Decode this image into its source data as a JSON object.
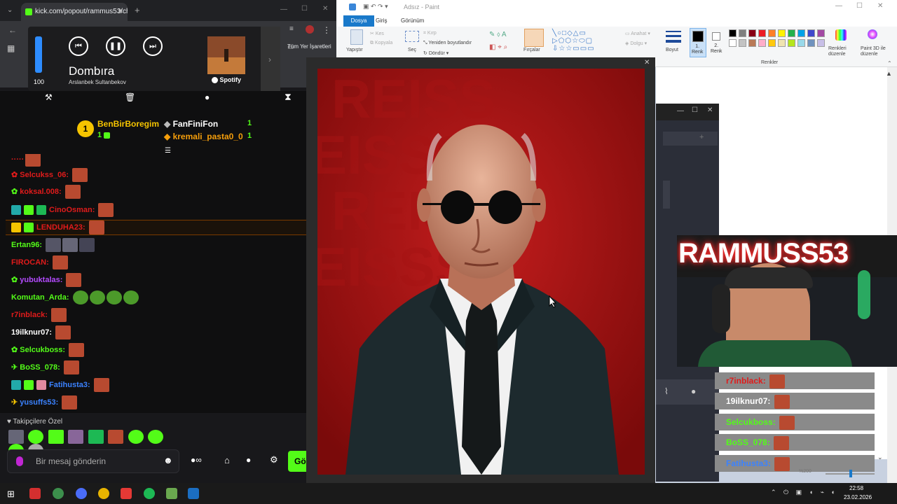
{
  "chrome": {
    "tab_title": "kick.com/popout/rammus53/ch",
    "bookmark": "Tüm Yer İşaretleri"
  },
  "spotify": {
    "volume": "100",
    "volume_level": 1.0,
    "track": "Dombıra",
    "artist": "Arslanbek Sultanbekov",
    "brand": "Spotify",
    "prev_icon": "skip-back-icon",
    "play_icon": "pause-icon",
    "next_icon": "skip-forward-icon"
  },
  "kick": {
    "leaderboard": [
      {
        "rank": "1",
        "name": "BenBirBoregim",
        "count": "1"
      },
      {
        "name": "FanFiniFon",
        "count": "1"
      },
      {
        "name": "kremali_pasta0_0",
        "count": "1"
      }
    ],
    "messages": [
      {
        "user": "Selcukss_06",
        "color": "#e01b1b"
      },
      {
        "user": "koksal.008",
        "color": "#e01b1b"
      },
      {
        "user": "CinoOsman",
        "color": "#e01b1b"
      },
      {
        "user": "LENDUHA23",
        "color": "#e01b1b"
      },
      {
        "user": "Ertan96",
        "color": "#53fc18"
      },
      {
        "user": "FIROCAN",
        "color": "#e01b1b"
      },
      {
        "user": "yubuktalas",
        "color": "#b44bff"
      },
      {
        "user": "Komutan_Arda",
        "color": "#53fc18"
      },
      {
        "user": "r7inblack",
        "color": "#e01b1b"
      },
      {
        "user": "19ilknur07",
        "color": "#ffffff"
      },
      {
        "user": "Selcukboss",
        "color": "#53fc18"
      },
      {
        "user": "BoSS_078",
        "color": "#53fc18"
      },
      {
        "user": "Fatihusta3",
        "color": "#3b82ff"
      },
      {
        "user": "yusuffs53",
        "color": "#3b82ff"
      }
    ],
    "followers_label": "Takipçilere Özel",
    "chat_placeholder": "Bir mesaj gönderin",
    "send_label": "Gö"
  },
  "paint": {
    "title": "Adsız - Paint",
    "menu": [
      "Dosya",
      "Giriş",
      "Görünüm"
    ],
    "ribbon": {
      "paste": "Yapıştır",
      "cut": "Kes",
      "copy": "Kopyala",
      "select": "Seç",
      "crop": "Kırp",
      "resize": "Yeniden boyutlandır",
      "rotate": "Döndür",
      "brushes": "Fırçalar",
      "outline": "Anahat",
      "fill": "Dolgu",
      "size": "Boyut",
      "color1": "1.\nRenk",
      "color2": "2.\nRenk",
      "edit_colors": "Renkleri düzenle",
      "paint3d": "Paint 3D ile düzenle",
      "colors_group": "Renkler"
    },
    "zoom": "%200",
    "palette": [
      "#000000",
      "#7f7f7f",
      "#880015",
      "#ed1c24",
      "#ff7f27",
      "#fff200",
      "#22b14c",
      "#00a2e8",
      "#3f48cc",
      "#a349a4",
      "#ffffff",
      "#c3c3c3",
      "#b97a57",
      "#ffaec9",
      "#ffc90e",
      "#efe4b0",
      "#b5e61d",
      "#99d9ea",
      "#7092be",
      "#c8bfe7"
    ]
  },
  "overlay": {
    "cam_text": "RAMMUSS53",
    "messages": [
      "r7inblack:",
      "19ilknur07:",
      "Selcukboss:",
      "BoSS_078:",
      "Fatihusta3:"
    ]
  },
  "taskbar": {
    "time": "22:58",
    "date": "23.02.2026"
  }
}
